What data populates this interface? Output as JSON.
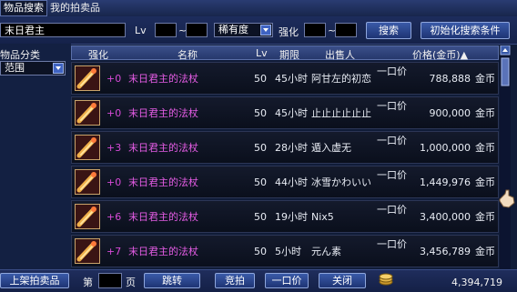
{
  "tabs": [
    {
      "label": "物品搜索",
      "active": true
    },
    {
      "label": "我的拍卖品",
      "active": false
    }
  ],
  "search": {
    "name_value": "末日君主",
    "lv_label": "Lv",
    "tilde": "~",
    "rarity_value": "稀有度",
    "enhance_label": "强化",
    "search_button": "搜索",
    "reset_button": "初始化搜索条件"
  },
  "category": {
    "label": "物品分类",
    "value": "范围"
  },
  "table": {
    "headers": {
      "enhance": "强化",
      "name": "名称",
      "lv": "Lv",
      "duration": "期限",
      "seller": "出售人",
      "price": "价格(金币)▲"
    },
    "rows": [
      {
        "enhance": "+0",
        "name": "末日君主的法杖",
        "lv": "50",
        "duration": "45小时",
        "seller": "阿甘左的初恋",
        "buyout_label": "一口价",
        "price": "788,888",
        "unit": "金币"
      },
      {
        "enhance": "+0",
        "name": "末日君主的法杖",
        "lv": "50",
        "duration": "45小时",
        "seller": "止止止止止止",
        "buyout_label": "一口价",
        "price": "900,000",
        "unit": "金币"
      },
      {
        "enhance": "+3",
        "name": "末日君主的法杖",
        "lv": "50",
        "duration": "28小时",
        "seller": "遁入虚无",
        "buyout_label": "一口价",
        "price": "1,000,000",
        "unit": "金币"
      },
      {
        "enhance": "+0",
        "name": "末日君主的法杖",
        "lv": "50",
        "duration": "44小时",
        "seller": "冰雪かわいい",
        "buyout_label": "一口价",
        "price": "1,449,976",
        "unit": "金币"
      },
      {
        "enhance": "+6",
        "name": "末日君主的法杖",
        "lv": "50",
        "duration": "19小时",
        "seller": "Nix5",
        "buyout_label": "一口价",
        "price": "3,400,000",
        "unit": "金币"
      },
      {
        "enhance": "+7",
        "name": "末日君主的法杖",
        "lv": "50",
        "duration": "5小时",
        "seller": "元ん素",
        "buyout_label": "一口价",
        "price": "3,456,789",
        "unit": "金币"
      }
    ]
  },
  "bottom": {
    "list_item_button": "上架拍卖品",
    "page_prefix": "第",
    "page_suffix": "页",
    "jump_button": "跳转",
    "bid_button": "竞拍",
    "buyout_button": "一口价",
    "close_button": "关闭",
    "gold_amount": "4,394,719"
  },
  "colors": {
    "item_name": "#e45ce4",
    "enhance": "#d84ad8",
    "text": "#f0f0f0"
  }
}
